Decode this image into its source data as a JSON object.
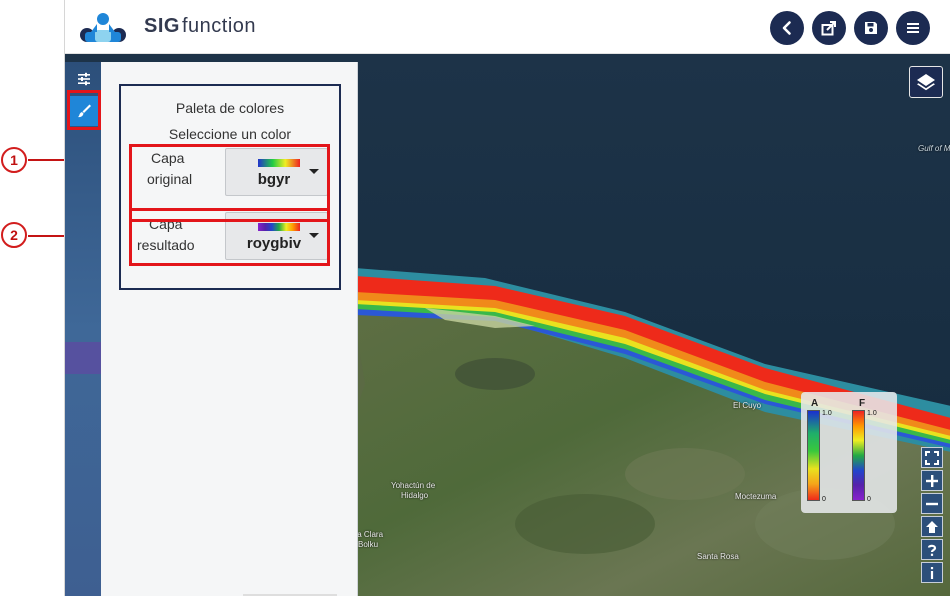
{
  "app": {
    "brand_bold": "SIG",
    "brand_light": "function"
  },
  "header": {
    "buttons": [
      {
        "name": "back-button",
        "icon": "chevron-left-icon"
      },
      {
        "name": "share-button",
        "icon": "share-icon"
      },
      {
        "name": "save-button",
        "icon": "save-icon"
      },
      {
        "name": "menu-button",
        "icon": "hamburger-icon"
      }
    ]
  },
  "sidebar": {
    "items": [
      {
        "name": "sidebar-item-settings",
        "icon": "sliders-icon",
        "active": false
      },
      {
        "name": "sidebar-item-style",
        "icon": "brush-icon",
        "active": true
      }
    ]
  },
  "panel": {
    "title": "Paleta de colores",
    "subtitle": "Seleccione un color",
    "rows": [
      {
        "label_line1": "Capa",
        "label_line2": "original",
        "value": "bgyr",
        "ramp": [
          "#2233cc",
          "#22cc44",
          "#eeee22",
          "#ee2222"
        ]
      },
      {
        "label_line1": "Capa",
        "label_line2": "resultado",
        "value": "roygbiv",
        "ramp": [
          "#ee2222",
          "#ff9900",
          "#eeee22",
          "#22aa44",
          "#2244cc",
          "#5522aa",
          "#8822cc"
        ]
      }
    ]
  },
  "annotations": {
    "callout_1": "1",
    "callout_2": "2"
  },
  "legend": {
    "a": {
      "letter": "A",
      "max": "1.0",
      "min": "0",
      "colors": [
        "#1a2fd0",
        "#1fae6a",
        "#39c83c",
        "#e9e21f",
        "#f5a51a",
        "#ef2a1a"
      ]
    },
    "f": {
      "letter": "F",
      "max": "1.0",
      "min": "0",
      "colors": [
        "#ee2222",
        "#ff9900",
        "#eeee22",
        "#22aa44",
        "#2244cc",
        "#5522aa",
        "#8822cc"
      ]
    }
  },
  "map": {
    "labels": {
      "gulf": "Gulf of M",
      "el_cuyo": "El Cuyo",
      "yohactun": "Yohactún de",
      "hidalgo": "Hidalgo",
      "moctezuma": "Moctezuma",
      "santa_clara": "ta Clara",
      "bolku": "Bolku",
      "santa_rosa": "Santa Rosa"
    }
  },
  "map_controls": [
    "fullscreen-icon",
    "plus-icon",
    "minus-icon",
    "arrow-up-icon",
    "help-icon",
    "info-icon"
  ],
  "colors": {
    "navy": "#1c2b52",
    "accent": "#1f86d8",
    "annotation_red": "#e3151a"
  }
}
